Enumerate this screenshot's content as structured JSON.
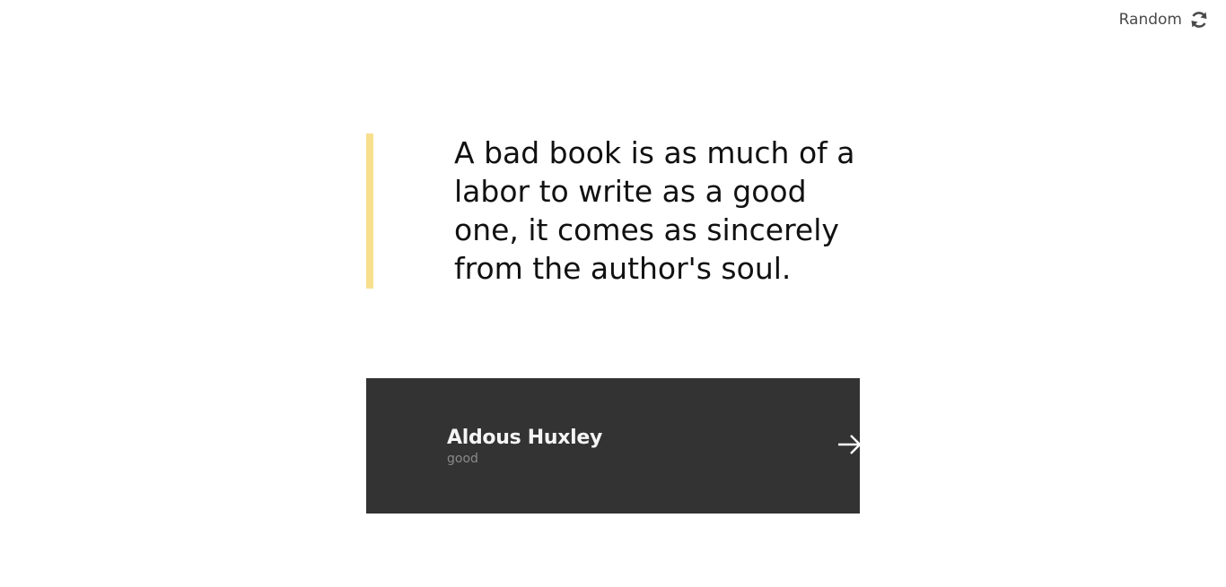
{
  "header": {
    "random_label": "Random",
    "random_icon": "refresh-icon"
  },
  "quote": {
    "text": "A bad book is as much of a labor to write as a good one, it comes as sincerely from the author's soul.",
    "accent_color": "#f8df8d"
  },
  "author_card": {
    "name": "Aldous Huxley",
    "tag": "good",
    "arrow_icon": "arrow-right-icon",
    "background_color": "#333333"
  }
}
